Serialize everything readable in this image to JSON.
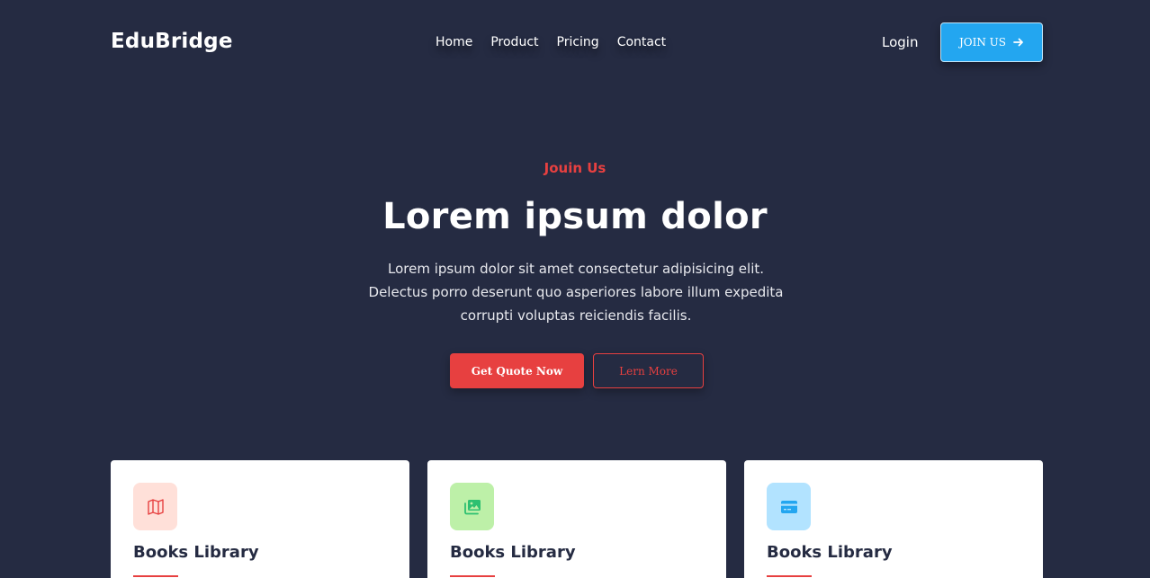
{
  "header": {
    "brand": "EduBridge",
    "nav": [
      "Home",
      "Product",
      "Pricing",
      "Contact"
    ],
    "login": "Login",
    "join_label": "JOIN US"
  },
  "hero": {
    "eyebrow": "Jouin Us",
    "title": "Lorem ipsum dolor",
    "description": "Lorem ipsum dolor sit amet consectetur adipisicing elit. Delectus porro deserunt quo asperiores labore illum expedita corrupti voluptas reiciendis facilis.",
    "primary_label": "Get Quote Now",
    "secondary_label": "Lern More"
  },
  "cards": [
    {
      "title": "Books Library",
      "icon": "map-icon",
      "icon_bg": "#ffe0d9",
      "icon_color": "#e74040"
    },
    {
      "title": "Books Library",
      "icon": "images-icon",
      "icon_bg": "#bdf0a8",
      "icon_color": "#2dc071"
    },
    {
      "title": "Books Library",
      "icon": "credit-card-icon",
      "icon_bg": "#b2e3ff",
      "icon_color": "#23a6f0"
    }
  ],
  "colors": {
    "background": "#252b42",
    "accent_red": "#e74040",
    "accent_blue": "#23a6f0",
    "text_dark": "#252b42"
  }
}
